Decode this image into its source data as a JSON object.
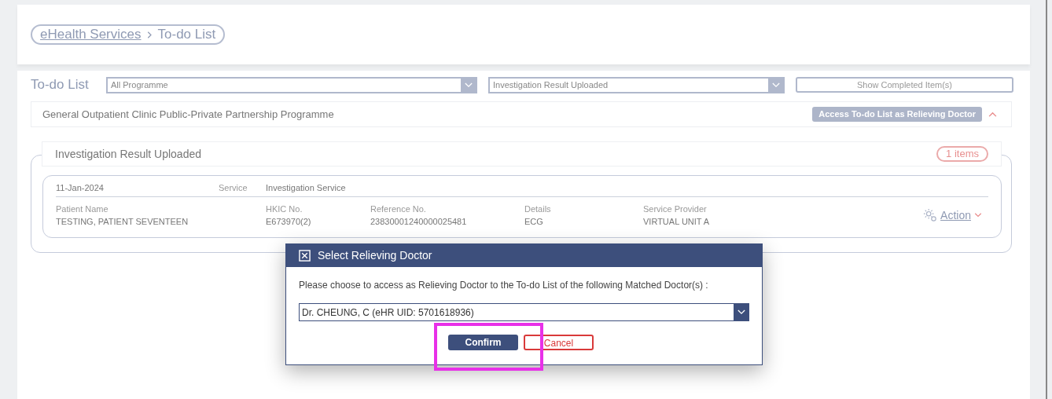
{
  "breadcrumb": [
    {
      "text": "eHealth Services",
      "link": true
    },
    {
      "text": "To-do List",
      "link": false
    }
  ],
  "filters": {
    "title": "To-do List",
    "programme": "All Programme",
    "result_type": "Investigation Result Uploaded",
    "show_completed": "Show Completed Item(s)"
  },
  "programme_panel": {
    "title": "General Outpatient Clinic Public-Private Partnership Programme",
    "relieving_button": "Access To-do List as Relieving Doctor",
    "expanded": true
  },
  "group": {
    "title": "Investigation Result Uploaded",
    "count": "1 items",
    "items": [
      {
        "date": "11-Jan-2024",
        "service_label": "Service",
        "service": "Investigation Service",
        "action": "Action",
        "fields": [
          {
            "label": "Patient Name",
            "value": "TESTING, PATIENT SEVENTEEN"
          },
          {
            "label": "HKIC No.",
            "value": "E673970(2)"
          },
          {
            "label": "Reference No.",
            "value": "23830001240000025481"
          },
          {
            "label": "Details",
            "value": "ECG"
          },
          {
            "label": "Service Provider",
            "value": "VIRTUAL UNIT A"
          }
        ]
      }
    ]
  },
  "dialog": {
    "title": "Select Relieving Doctor",
    "message": "Please choose to access as Relieving Doctor to the To-do List of the following Matched Doctor(s) :",
    "doctor": "Dr. CHEUNG, C (eHR UID: 5701618936)",
    "confirm": "Confirm",
    "cancel": "Cancel"
  }
}
